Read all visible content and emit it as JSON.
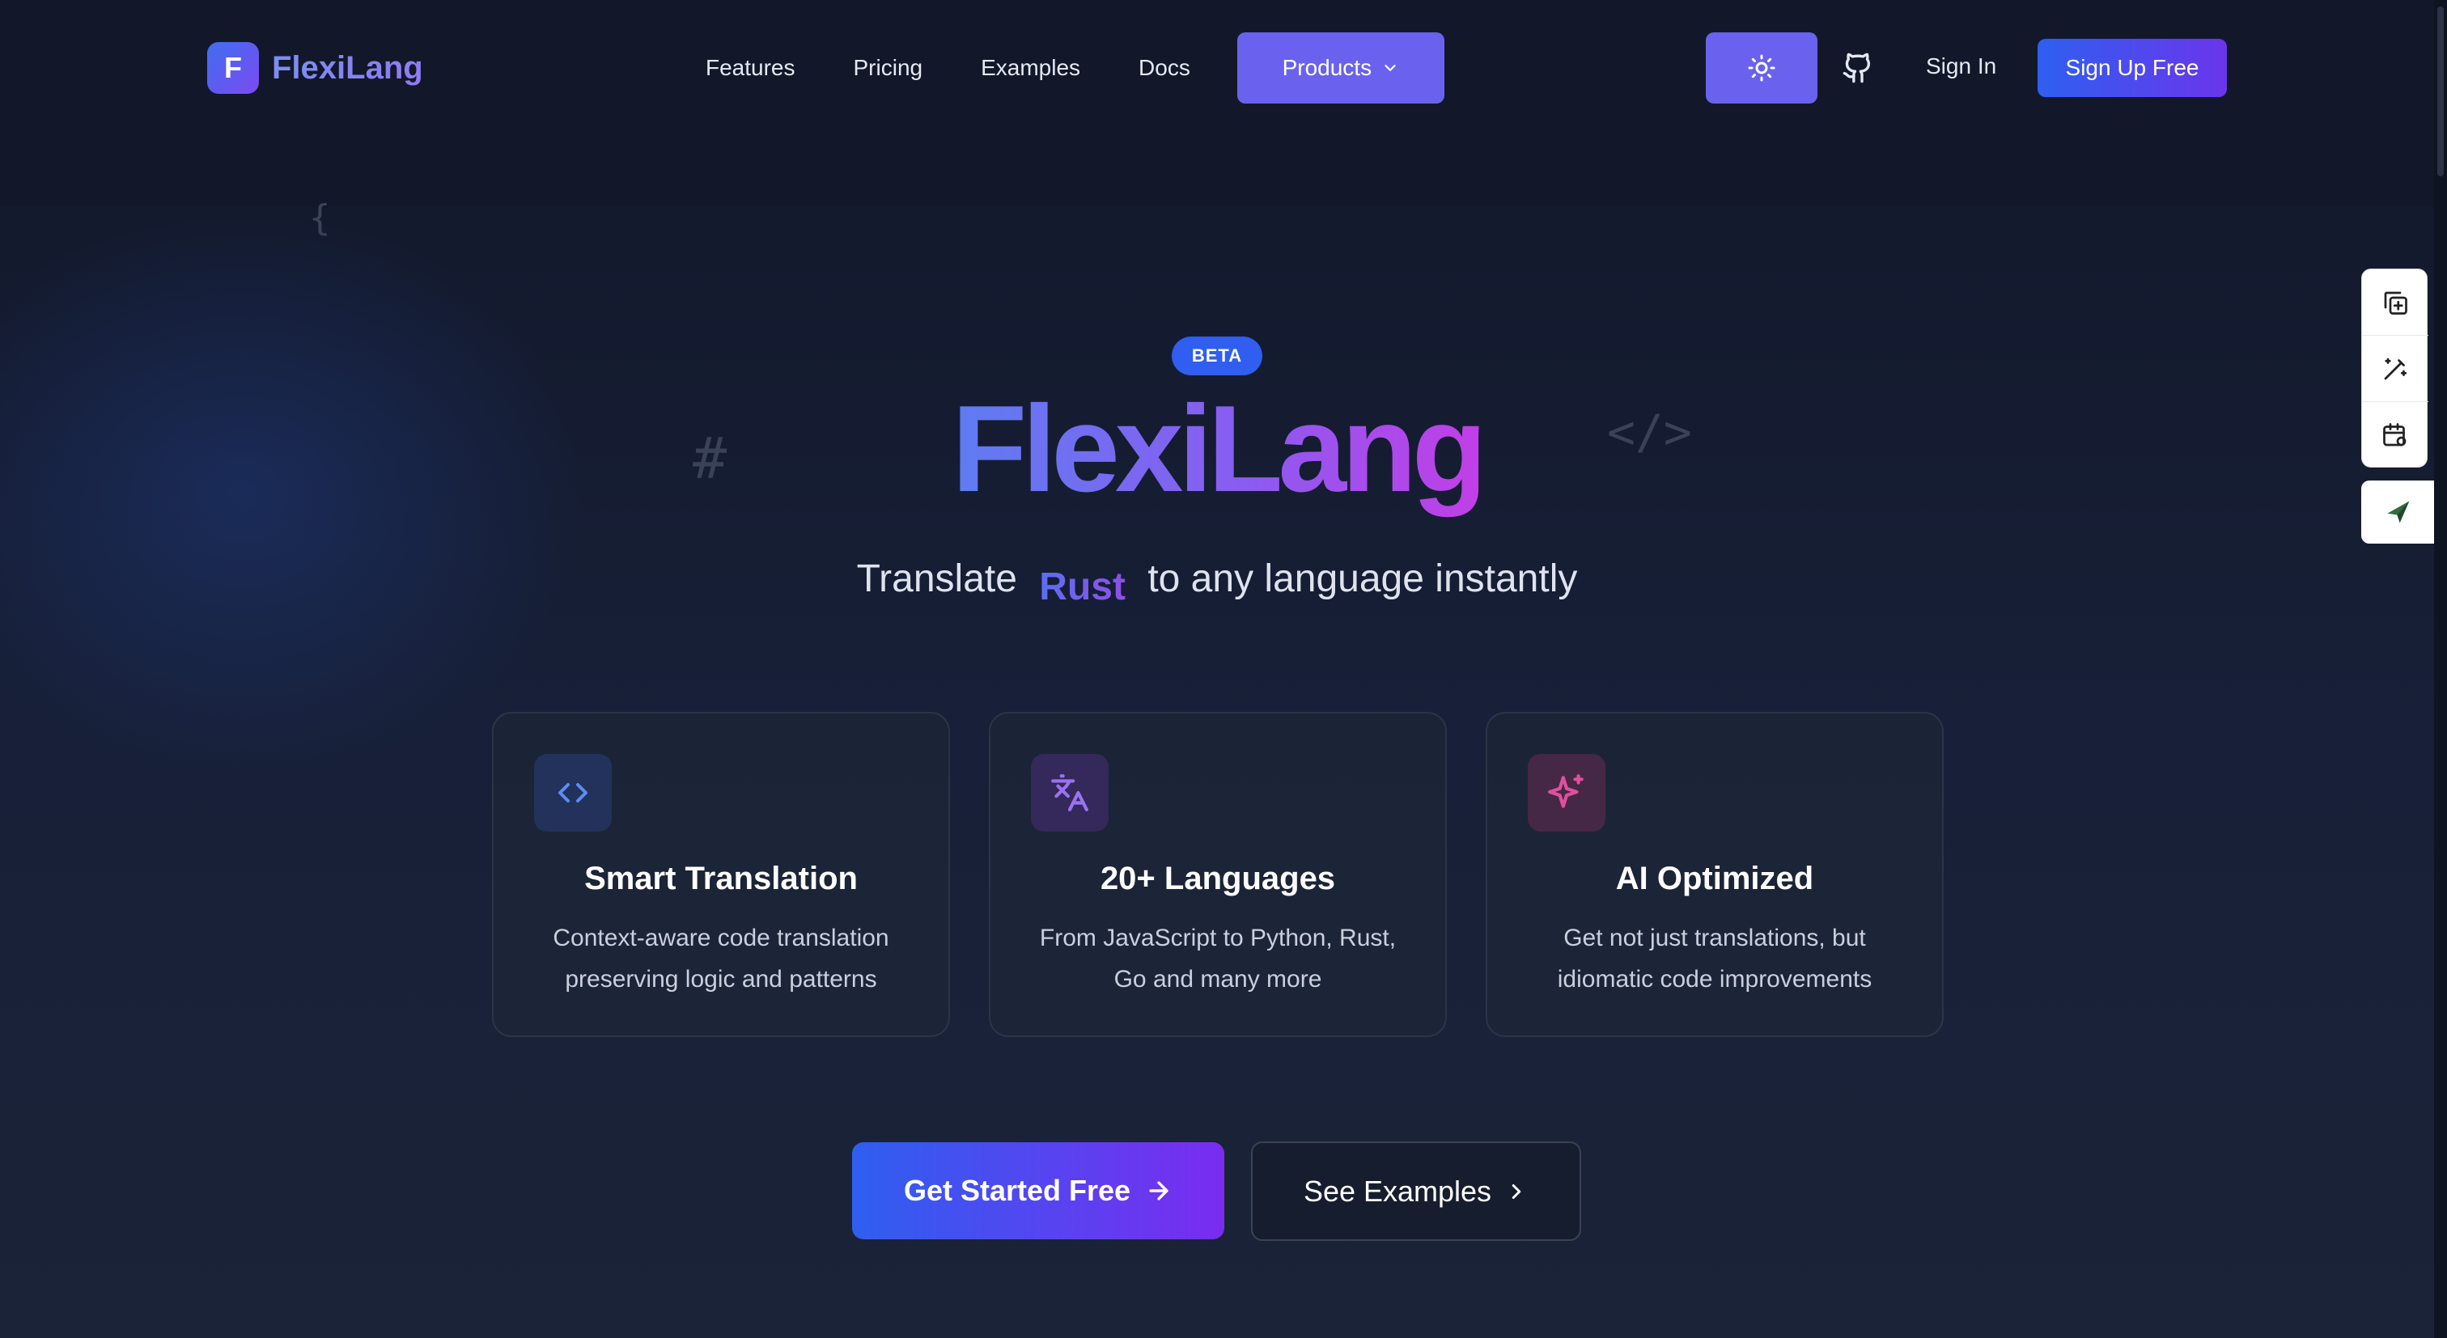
{
  "brand": {
    "logo_letter": "F",
    "name": "FlexiLang"
  },
  "nav": {
    "items": [
      {
        "label": "Features"
      },
      {
        "label": "Pricing"
      },
      {
        "label": "Examples"
      },
      {
        "label": "Docs"
      }
    ],
    "products_label": "Products"
  },
  "header_actions": {
    "theme_icon": "sun-icon",
    "github_icon": "github-icon",
    "sign_in": "Sign In",
    "sign_up": "Sign Up Free"
  },
  "decor": {
    "brace": "{",
    "hash": "#",
    "tag": "</>"
  },
  "hero": {
    "badge": "BETA",
    "title": "FlexiLang",
    "subtitle_prefix": "Translate",
    "subtitle_lang": "Rust",
    "subtitle_suffix": "to any language instantly"
  },
  "features": [
    {
      "icon": "code-icon",
      "title": "Smart Translation",
      "description": "Context-aware code translation preserving logic and patterns"
    },
    {
      "icon": "translate-icon",
      "title": "20+ Languages",
      "description": "From JavaScript to Python, Rust, Go and many more"
    },
    {
      "icon": "sparkle-icon",
      "title": "AI Optimized",
      "description": "Get not just translations, but idiomatic code improvements"
    }
  ],
  "cta": {
    "primary": "Get Started Free",
    "secondary": "See Examples"
  },
  "colors": {
    "accent_purple": "#6a62ee",
    "accent_blue": "#2f5ef0",
    "background": "#141a2c"
  }
}
